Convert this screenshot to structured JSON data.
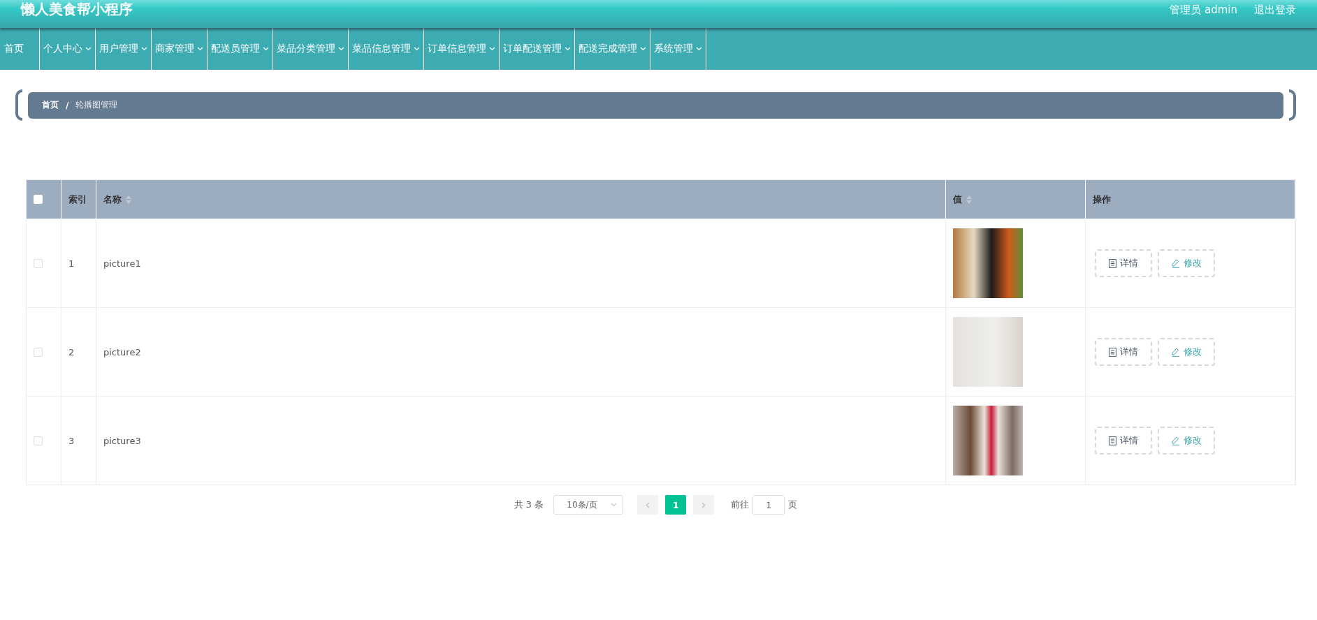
{
  "header": {
    "title": "懒人美食帮小程序",
    "user": "管理员 admin",
    "logout": "退出登录"
  },
  "nav": [
    {
      "label": "首页",
      "dropdown": false
    },
    {
      "label": "个人中心",
      "dropdown": true
    },
    {
      "label": "用户管理",
      "dropdown": true
    },
    {
      "label": "商家管理",
      "dropdown": true
    },
    {
      "label": "配送员管理",
      "dropdown": true
    },
    {
      "label": "菜品分类管理",
      "dropdown": true
    },
    {
      "label": "菜品信息管理",
      "dropdown": true
    },
    {
      "label": "订单信息管理",
      "dropdown": true
    },
    {
      "label": "订单配送管理",
      "dropdown": true
    },
    {
      "label": "配送完成管理",
      "dropdown": true
    },
    {
      "label": "系统管理",
      "dropdown": true
    }
  ],
  "breadcrumb": {
    "home": "首页",
    "separator": "/",
    "current": "轮播图管理"
  },
  "table": {
    "select_all_checked": false,
    "columns": [
      {
        "label": "索引",
        "sortable": false
      },
      {
        "label": "名称",
        "sortable": true
      },
      {
        "label": "值",
        "sortable": true
      },
      {
        "label": "操作",
        "sortable": false
      }
    ],
    "rows": [
      {
        "checked": false,
        "index": "1",
        "name": "picture1",
        "detail": "详情",
        "edit": "修改"
      },
      {
        "checked": false,
        "index": "2",
        "name": "picture2",
        "detail": "详情",
        "edit": "修改"
      },
      {
        "checked": false,
        "index": "3",
        "name": "picture3",
        "detail": "详情",
        "edit": "修改"
      }
    ]
  },
  "pagination": {
    "total": "共 3 条",
    "page_size": "10条/页",
    "pages": [
      {
        "label": "1",
        "selected": true
      }
    ],
    "goto_label": "前往",
    "goto_value": "1",
    "goto_suffix": "页"
  }
}
